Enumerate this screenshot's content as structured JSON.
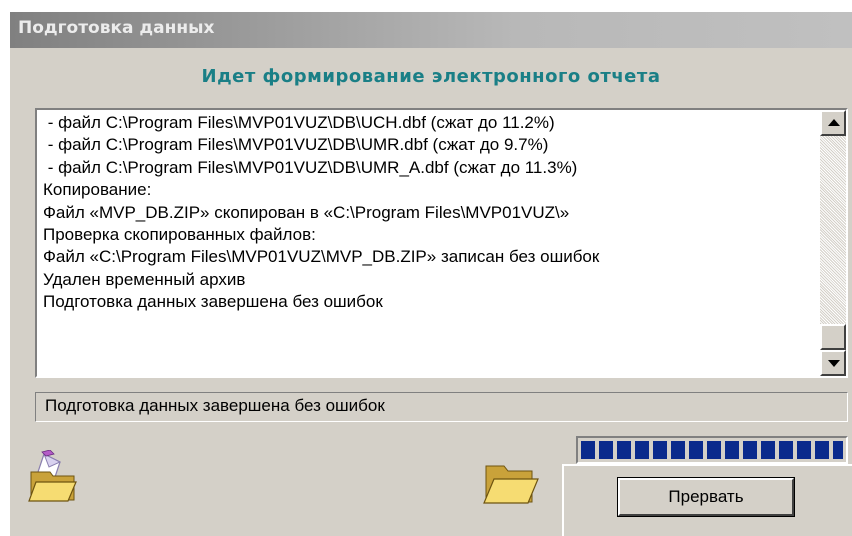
{
  "window": {
    "title": "Подготовка данных"
  },
  "heading": "Идет формирование электронного отчета",
  "log": {
    "lines": [
      " - файл C:\\Program Files\\MVP01VUZ\\DB\\UCH.dbf (сжат до 11.2%)",
      " - файл C:\\Program Files\\MVP01VUZ\\DB\\UMR.dbf (сжат до 9.7%)",
      " - файл C:\\Program Files\\MVP01VUZ\\DB\\UMR_A.dbf (сжат до 11.3%)",
      "Копирование:",
      "Файл «MVP_DB.ZIP» скопирован в «C:\\Program Files\\MVP01VUZ\\»",
      "Проверка скопированных файлов:",
      "Файл «C:\\Program Files\\MVP01VUZ\\MVP_DB.ZIP» записан без ошибок",
      "Удален временный архив",
      "Подготовка данных завершена без ошибок"
    ]
  },
  "status": {
    "text": "Подготовка данных завершена без ошибок"
  },
  "progress": {
    "fraction": 1.0
  },
  "buttons": {
    "abort": "Прервать"
  },
  "icons": {
    "left": "open-folder-envelope-icon",
    "right": "open-folder-icon"
  },
  "colors": {
    "heading": "#1a7f86",
    "progress": "#0a2a8c",
    "face": "#d4d0c8"
  }
}
